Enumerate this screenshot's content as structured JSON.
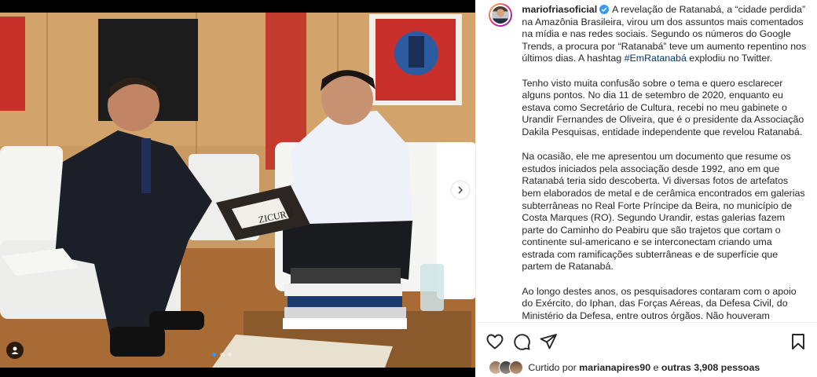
{
  "post": {
    "username": "mariofriasoficial",
    "caption": {
      "intro": "A revelação de Ratanabá, a “cidade perdida” na Amazônia Brasileira, virou um dos assuntos mais comentados na mídia e nas redes sociais. Segundo os números do Google Trends, a procura por “Ratanabá” teve um aumento repentino nos últimos dias. A hashtag",
      "hashtag": "#EmRatanabá",
      "intro_end": "explodiu no Twitter.",
      "paragraph_2": "Tenho visto muita confusão sobre o tema e quero esclarecer alguns pontos. No dia 11 de setembro de 2020, enquanto eu estava como Secretário de Cultura, recebi no meu gabinete o Urandir Fernandes de Oliveira, que é o presidente da Associação Dakila Pesquisas, entidade independente que revelou Ratanabá.",
      "paragraph_3": "Na ocasião, ele me apresentou um documento que resume os estudos iniciados pela associação desde 1992, ano em que Ratanabá teria sido descoberta. Vi diversas fotos de artefatos bem elaborados de metal e de cerâmica encontrados em galerias subterrâneas no Real Forte Príncipe da Beira, no município de Costa Marques (RO). Segundo Urandir, estas galerias fazem parte do Caminho do Peabiru que são trajetos que cortam o continente sul-americano e se interconectam criando uma estrada com ramificações subterrâneas e de superfície que partem de Ratanabá.",
      "paragraph_4": "Ao longo destes anos, os pesquisadores contaram com o apoio do Exército, do Iphan, das Forças Aéreas, da Defesa Civil, do Ministério da Defesa, entre outros órgãos. Não houveram"
    },
    "photo": {
      "book_text": "ZICURU"
    },
    "likes": {
      "prefix": "Curtido por",
      "user": "marianapires90",
      "middle": "e",
      "others": "outras 3,908 pessoas"
    },
    "colors": {
      "hashtag": "#00376b",
      "verified": "#3897f0",
      "text": "#262626"
    },
    "icons": [
      "heart-icon",
      "comment-icon",
      "share-icon",
      "bookmark-icon",
      "chevron-right-icon",
      "user-tag-icon",
      "verified-badge-icon"
    ]
  }
}
